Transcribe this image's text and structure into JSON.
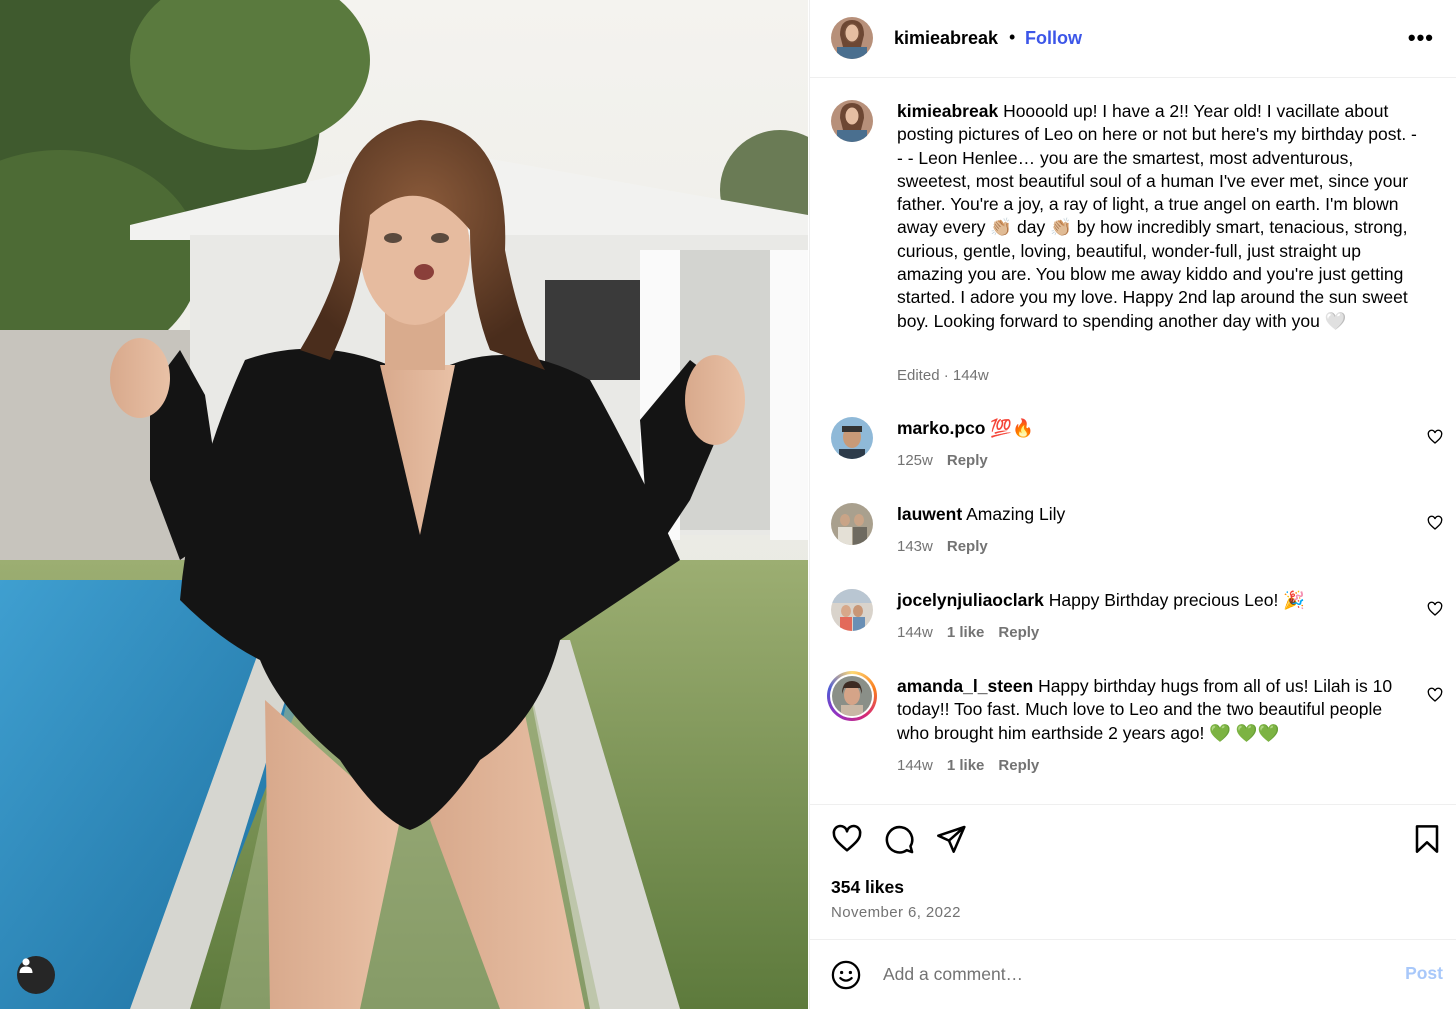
{
  "post": {
    "image": {
      "alt": "Woman in black bodysuit standing by pool in front of white pool house"
    },
    "user_tag_icon": "person-icon"
  },
  "header": {
    "username": "kimieabreak",
    "separator": "•",
    "follow_label": "Follow",
    "more_icon": "ellipsis-icon",
    "more_label": "•••"
  },
  "caption": {
    "username": "kimieabreak",
    "text": "Hoooold up! I have a 2!! Year old! I vacillate about posting pictures of Leo on here or not but here's my birthday post. - - - Leon Henlee… you are the smartest, most adventurous, sweetest, most beautiful soul of a human I've ever met, since your father. You're a joy, a ray of light, a true angel on earth. I'm blown away every 👏🏼 day 👏🏼 by how incredibly smart, tenacious, strong, curious, gentle, loving, beautiful, wonder-full, just straight up amazing you are. You blow me away kiddo and you're just getting started. I adore you my love. Happy 2nd lap around the sun sweet boy. Looking forward to spending another day with you 🤍",
    "meta": "Edited · 144w"
  },
  "comments": [
    {
      "username": "marko.pco",
      "text": "💯🔥",
      "time": "125w",
      "likes": "",
      "reply": "Reply"
    },
    {
      "username": "lauwent",
      "text": "Amazing Lily",
      "time": "143w",
      "likes": "",
      "reply": "Reply"
    },
    {
      "username": "jocelynjuliaoclark",
      "text": "Happy Birthday precious Leo! 🎉",
      "time": "144w",
      "likes": "1 like",
      "reply": "Reply"
    },
    {
      "username": "amanda_l_steen",
      "text": "Happy birthday hugs from all of us! Lilah is 10 today!! Too fast. Much love to Leo and the two beautiful people who brought him earthside 2 years ago! 💚 💚💚",
      "time": "144w",
      "likes": "1 like",
      "reply": "Reply"
    }
  ],
  "actions": {
    "like_icon": "heart-icon",
    "comment_icon": "comment-bubble-icon",
    "share_icon": "paper-plane-icon",
    "save_icon": "bookmark-icon",
    "likes": "354 likes",
    "date": "November 6, 2022"
  },
  "add_comment": {
    "emoji_icon": "smiley-icon",
    "placeholder": "Add a comment…",
    "post_label": "Post"
  },
  "colors": {
    "follow": "#3c56e8",
    "post_disabled": "#a8c8fa",
    "secondary_text": "#737373",
    "divider": "#efefef"
  }
}
